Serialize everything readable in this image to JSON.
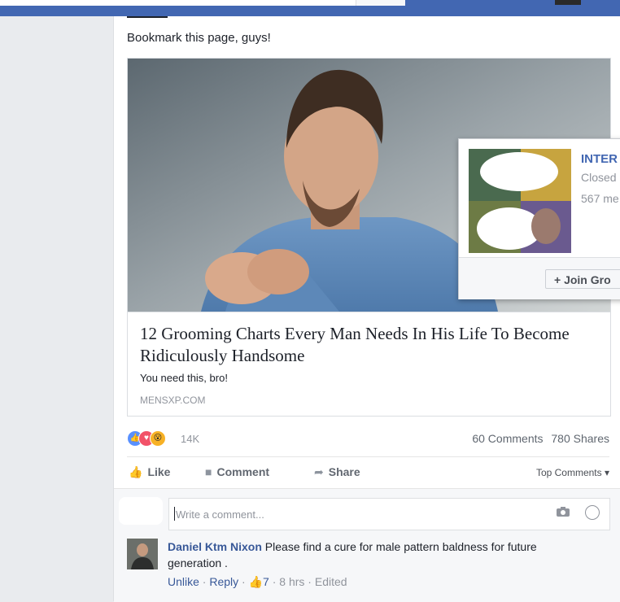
{
  "post": {
    "text": "Bookmark this page, guys!",
    "link": {
      "title": "12 Grooming Charts Every Man Needs In His Life To Become Ridiculously Handsome",
      "description": "You need this, bro!",
      "domain": "MENSXP.COM"
    }
  },
  "stats": {
    "reaction_count": "14K",
    "comments": "60 Comments",
    "shares": "780 Shares"
  },
  "actions": {
    "like": "Like",
    "comment": "Comment",
    "share": "Share",
    "top_comments": "Top Comments ▾"
  },
  "comment_input": {
    "placeholder": "Write a comment..."
  },
  "comment": {
    "author": "Daniel Ktm Nixon",
    "text": "Please find a cure for male pattern baldness for future generation .",
    "unlike": "Unlike",
    "reply": "Reply",
    "likes": "7",
    "time": "8 hrs",
    "edited": "Edited"
  },
  "group_popup": {
    "name": "INTER",
    "privacy": "Closed",
    "members": "567 me",
    "join": "+ Join Gro"
  },
  "colors": {
    "topbar": "#4267b2",
    "link": "#385898",
    "muted": "#90949c"
  }
}
